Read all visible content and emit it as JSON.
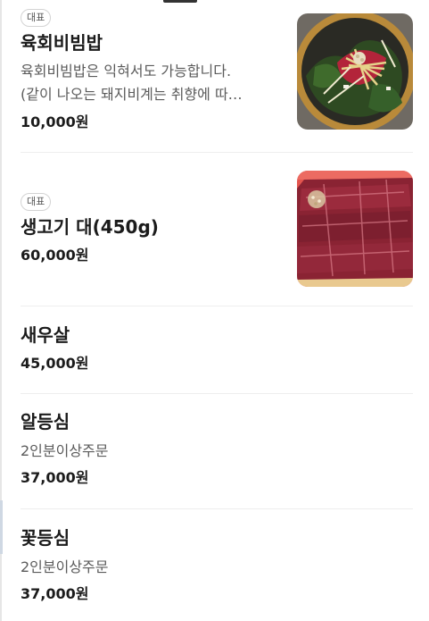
{
  "menu": {
    "items": [
      {
        "badge": "대표",
        "name": "육회비빔밥",
        "desc_line1": "육회비빔밥은 익혀서도 가능합니다.",
        "desc_line2": "(같이 나오는 돼지비계는 취향에 따…",
        "price": "10,000원",
        "image": "yukhoe-bibimbap-photo"
      },
      {
        "badge": "대표",
        "name": "생고기 대(450g)",
        "price": "60,000원",
        "image": "raw-beef-platter-photo"
      },
      {
        "name": "새우살",
        "price": "45,000원"
      },
      {
        "name": "알등심",
        "desc": "2인분이상주문",
        "price": "37,000원"
      },
      {
        "name": "꽃등심",
        "desc": "2인분이상주문",
        "price": "37,000원"
      }
    ]
  }
}
